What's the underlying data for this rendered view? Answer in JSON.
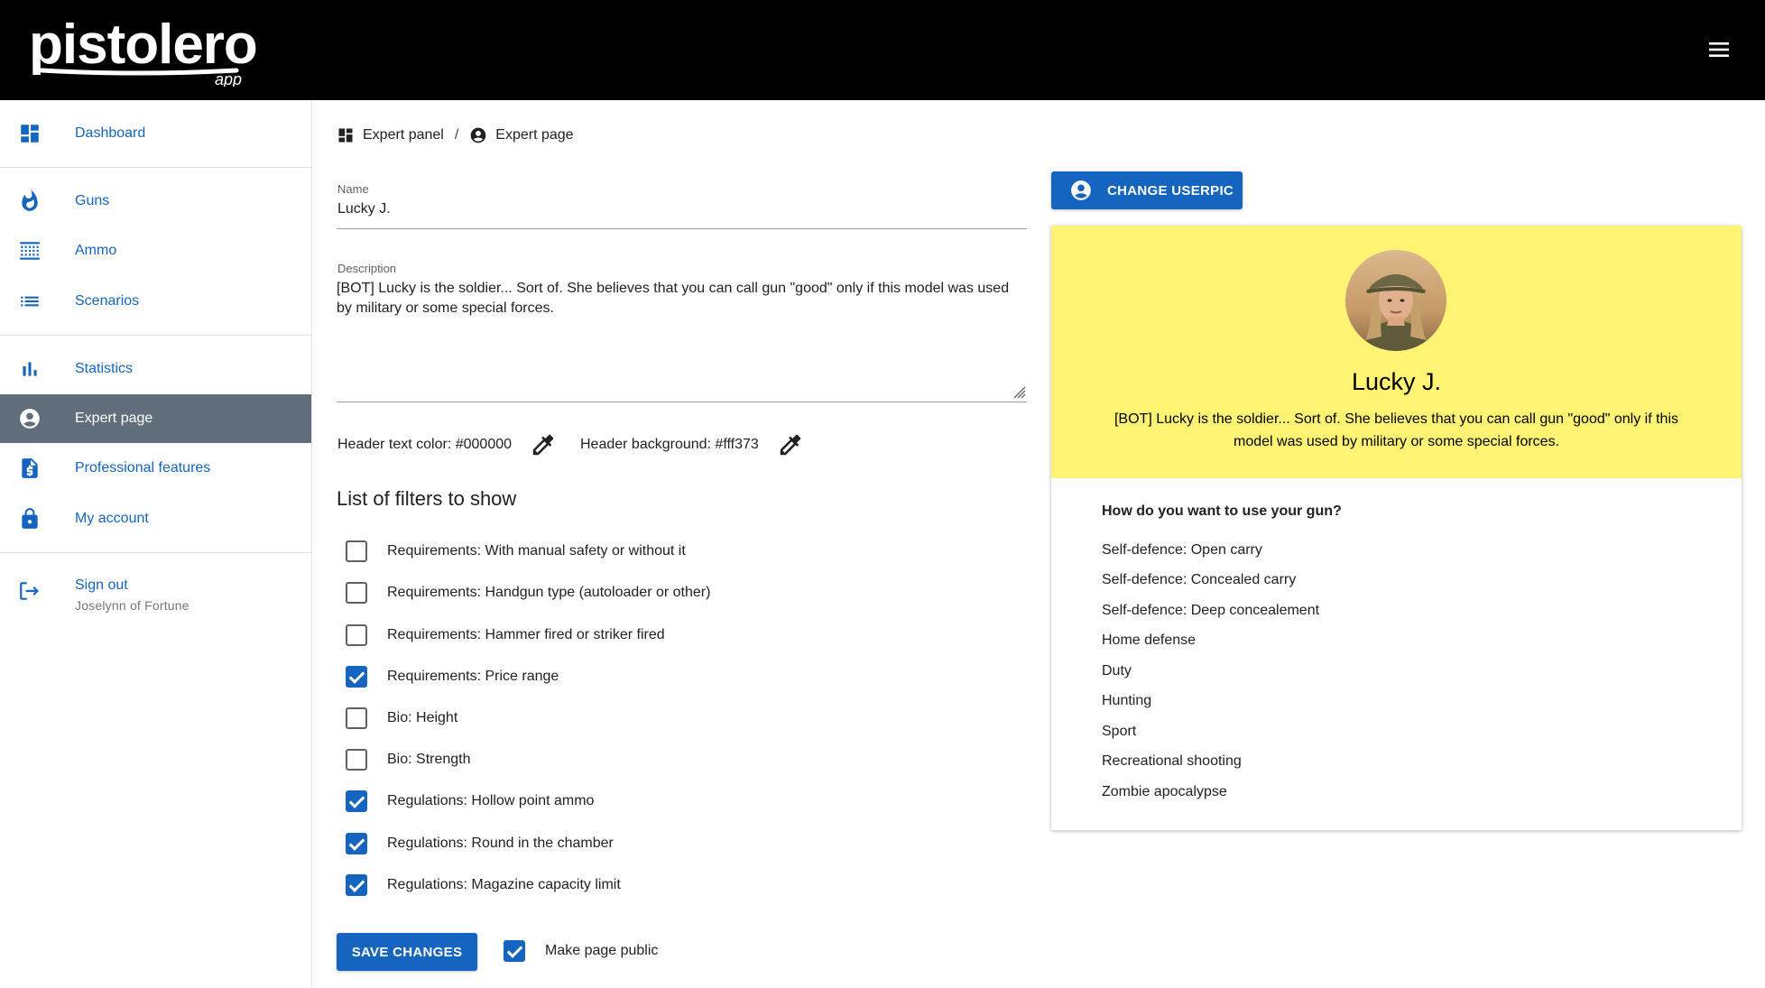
{
  "app": {
    "logo_text": "pistolero",
    "logo_sub": "app"
  },
  "sidebar": {
    "items": [
      {
        "label": "Dashboard",
        "icon": "dashboard-icon"
      },
      {
        "label": "Guns",
        "icon": "flame-icon"
      },
      {
        "label": "Ammo",
        "icon": "ammo-icon"
      },
      {
        "label": "Scenarios",
        "icon": "list-icon"
      },
      {
        "label": "Statistics",
        "icon": "bar-chart-icon"
      },
      {
        "label": "Expert page",
        "icon": "account-circle-icon",
        "active": true
      },
      {
        "label": "Professional features",
        "icon": "invoice-dollar-icon"
      },
      {
        "label": "My account",
        "icon": "lock-icon"
      }
    ],
    "signout": {
      "label": "Sign out",
      "user": "Joselynn of Fortune",
      "icon": "logout-icon"
    }
  },
  "breadcrumb": {
    "parent": "Expert panel",
    "separator": "/",
    "current": "Expert page"
  },
  "form": {
    "name_label": "Name",
    "name_value": "Lucky J.",
    "description_label": "Description",
    "description_value": "[BOT] Lucky is the soldier... Sort of. She believes that you can call gun \"good\" only if this model was used by military or some special forces.",
    "header_text_color_label": "Header text color: #000000",
    "header_background_label": "Header background: #fff373",
    "header_text_color": "#000000",
    "header_background": "#fff373"
  },
  "filters": {
    "title": "List of filters to show",
    "items": [
      {
        "label": "Requirements: With manual safety or without it",
        "checked": false
      },
      {
        "label": "Requirements: Handgun type (autoloader or other)",
        "checked": false
      },
      {
        "label": "Requirements: Hammer fired or striker fired",
        "checked": false
      },
      {
        "label": "Requirements: Price range",
        "checked": true
      },
      {
        "label": "Bio: Height",
        "checked": false
      },
      {
        "label": "Bio: Strength",
        "checked": false
      },
      {
        "label": "Regulations: Hollow point ammo",
        "checked": true
      },
      {
        "label": "Regulations: Round in the chamber",
        "checked": true
      },
      {
        "label": "Regulations: Magazine capacity limit",
        "checked": true
      }
    ]
  },
  "actions": {
    "save_label": "SAVE CHANGES",
    "public_label": "Make page public",
    "public_checked": true,
    "change_userpic_label": "CHANGE USERPIC"
  },
  "preview": {
    "name": "Lucky J.",
    "description": "[BOT] Lucky is the soldier... Sort of. She believes that you can call gun \"good\" only if this model was used by military or some special forces.",
    "question": "How do you want to use your gun?",
    "uses": [
      "Self-defence: Open carry",
      "Self-defence: Concealed carry",
      "Self-defence: Deep concealement",
      "Home defense",
      "Duty",
      "Hunting",
      "Sport",
      "Recreational shooting",
      "Zombie apocalypse"
    ]
  },
  "colors": {
    "accent": "#1565c0",
    "active_nav_bg": "#616f7c",
    "topbar": "#000000"
  }
}
